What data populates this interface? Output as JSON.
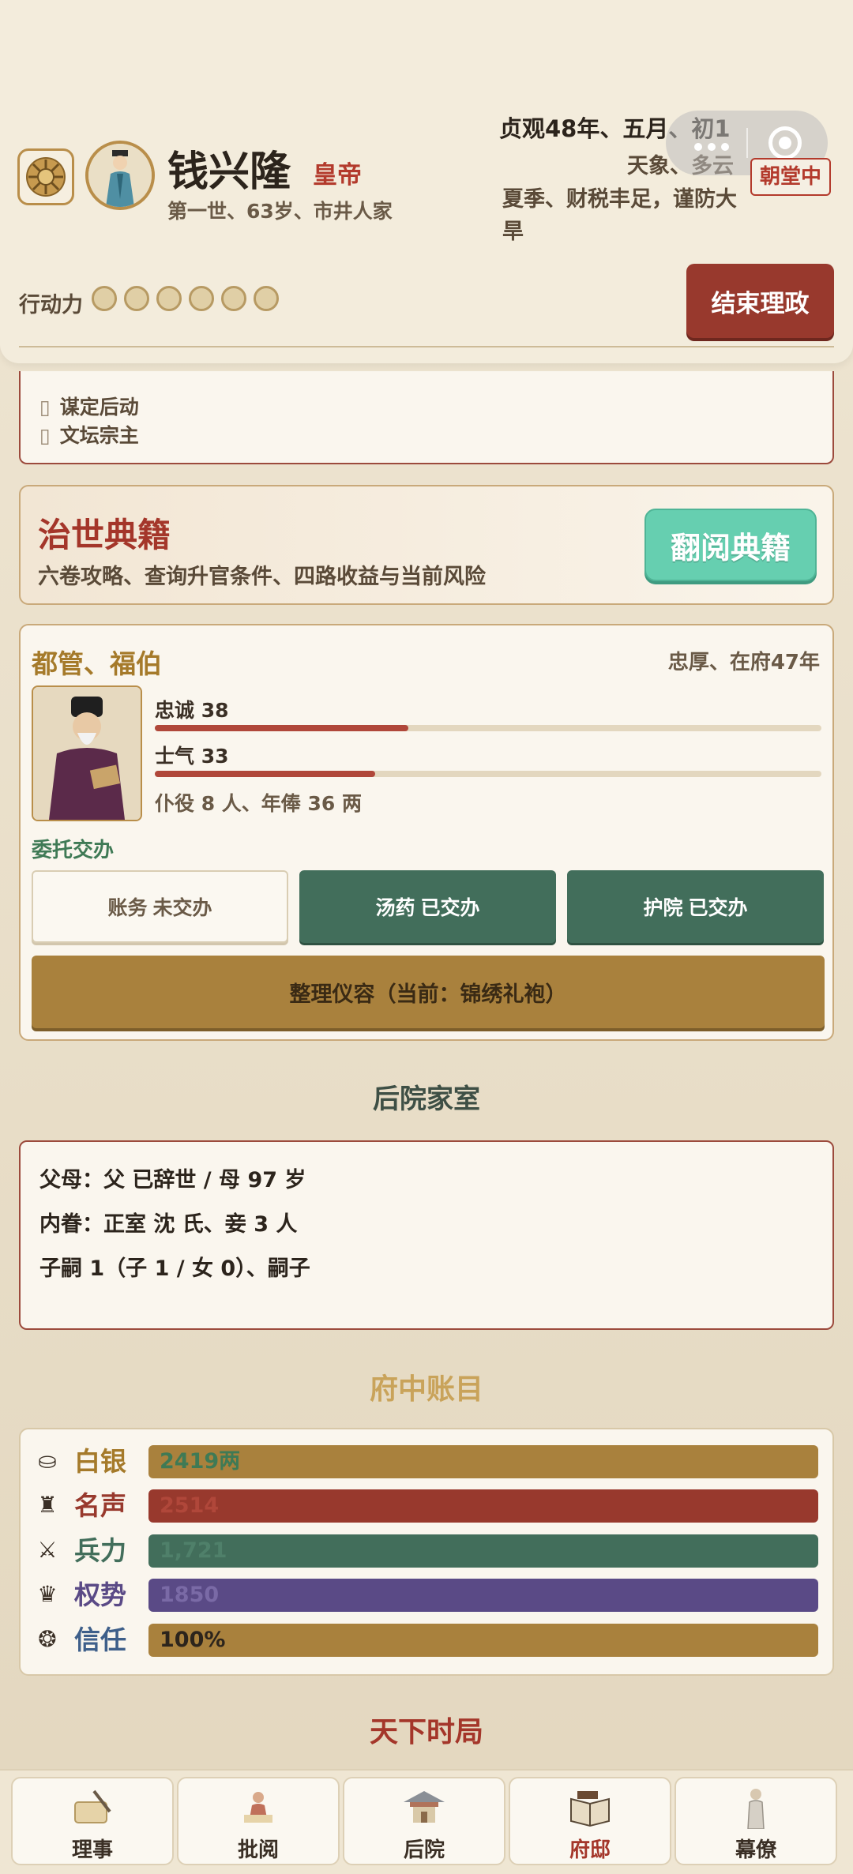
{
  "header": {
    "name": "钱兴隆",
    "rank": "皇帝",
    "subinfo": "第一世、63岁、市井人家",
    "date": "贞观48年、五月、初1",
    "weather": "天象、多云",
    "season": "夏季、财税丰足，谨防大旱",
    "court_badge": "朝堂中",
    "action_label": "行动力",
    "action_points_total": 6,
    "end_button": "结束理政"
  },
  "partial_list": {
    "items": [
      "谋定后动",
      "文坛宗主"
    ]
  },
  "classics": {
    "title": "治世典籍",
    "desc": "六卷攻略、查询升官条件、四路收益与当前风险",
    "button": "翻阅典籍"
  },
  "steward": {
    "title": "都管、福伯",
    "meta": "忠厚、在府47年",
    "loyalty_label": "忠诚 38",
    "loyalty_value": 38,
    "morale_label": "士气 33",
    "morale_value": 33,
    "servants": "仆役 8 人、年俸 36 两",
    "delegate_label": "委托交办",
    "tasks": [
      {
        "label": "账务 未交办",
        "done": false
      },
      {
        "label": "汤药 已交办",
        "done": true
      },
      {
        "label": "护院 已交办",
        "done": true
      }
    ],
    "groom_button": "整理仪容（当前：锦绣礼袍）"
  },
  "family": {
    "section_title": "后院家室",
    "parents": "父母：父 已辞世 / 母 97 岁",
    "spouses": "内眷：正室 沈 氏、妾 3 人",
    "children": "子嗣 1（子 1 / 女 0）、嗣子"
  },
  "accounts": {
    "section_title": "府中账目",
    "rows": [
      {
        "icon": "silver-icon",
        "label": "白银",
        "value": "2419两",
        "color": "#a9813d",
        "label_color": "#a57a2a",
        "text_color": "#3f7a55"
      },
      {
        "icon": "fame-icon",
        "label": "名声",
        "value": "2514",
        "color": "#98392d",
        "label_color": "#98392d",
        "text_color": "#b0473a"
      },
      {
        "icon": "troops-icon",
        "label": "兵力",
        "value": "1,721",
        "color": "#426e5b",
        "label_color": "#426e5b",
        "text_color": "#4f806a"
      },
      {
        "icon": "power-icon",
        "label": "权势",
        "value": "1850",
        "color": "#5a4a86",
        "label_color": "#5a4a86",
        "text_color": "#7a6aa6"
      },
      {
        "icon": "trust-icon",
        "label": "信任",
        "value": "100%",
        "color": "#a9813d",
        "label_color": "#3e5f8a",
        "text_color": "#2c241c"
      }
    ]
  },
  "world": {
    "section_title": "天下时局"
  },
  "nav": [
    {
      "label": "理事",
      "icon": "scroll-brush-icon",
      "active": false
    },
    {
      "label": "批阅",
      "icon": "reading-icon",
      "active": false
    },
    {
      "label": "后院",
      "icon": "pavilion-icon",
      "active": false
    },
    {
      "label": "府邸",
      "icon": "books-icon",
      "active": true
    },
    {
      "label": "幕僚",
      "icon": "advisor-icon",
      "active": false
    }
  ]
}
